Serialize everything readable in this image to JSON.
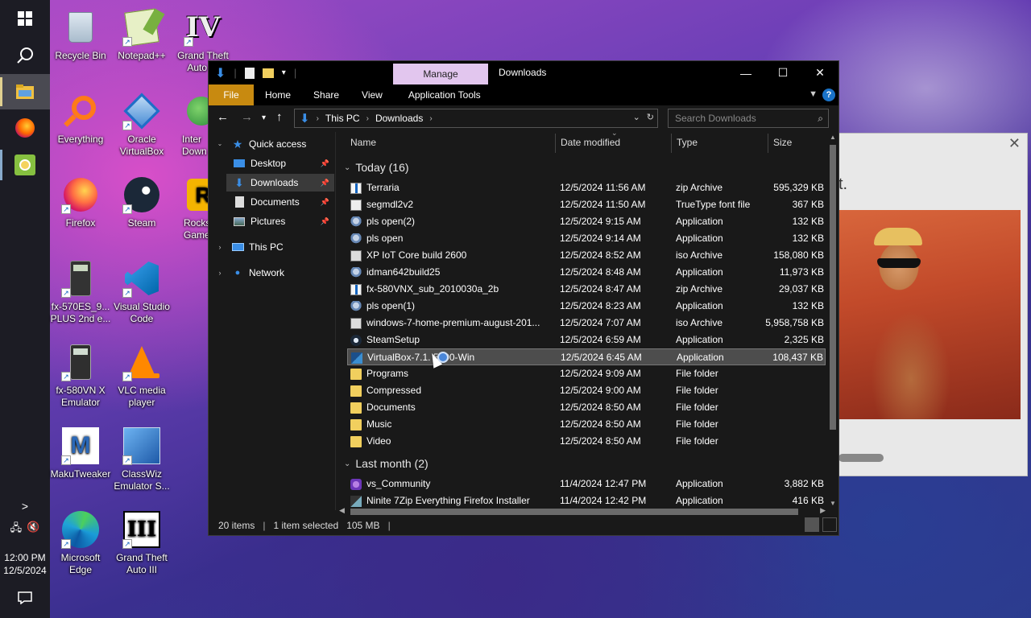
{
  "taskbar": {
    "clock_time": "12:00 PM",
    "clock_date": "12/5/2024"
  },
  "desktop_icons": [
    {
      "label": "Recycle Bin"
    },
    {
      "label": "Notepad++"
    },
    {
      "label": "Grand Theft Auto IV",
      "display": "Grand Theft\nAuto IV"
    },
    {
      "label": "Everything"
    },
    {
      "label": "Oracle VirtualBox",
      "display": "Oracle\nVirtualBox"
    },
    {
      "label": "Internet Download",
      "display": "Inter\nDown"
    },
    {
      "label": "Firefox"
    },
    {
      "label": "Steam"
    },
    {
      "label": "Rockstar Games",
      "display": "Rocks\nGame"
    },
    {
      "label": "fx-570ES PLUS 2nd e...",
      "display": "fx-570ES_9...\nPLUS 2nd e..."
    },
    {
      "label": "Visual Studio Code",
      "display": "Visual Studio\nCode"
    },
    {
      "label": "fx-580VN X Emulator",
      "display": "fx-580VN X\nEmulator"
    },
    {
      "label": "VLC media player",
      "display": "VLC media\nplayer"
    },
    {
      "label": "MakuTweaker"
    },
    {
      "label": "ClassWiz Emulator S...",
      "display": "ClassWiz\nEmulator S..."
    },
    {
      "label": "Microsoft Edge",
      "display": "Microsoft\nEdge"
    },
    {
      "label": "Grand Theft Auto III",
      "display": "Grand Theft\nAuto III"
    }
  ],
  "bg_window": {
    "text": "t."
  },
  "explorer": {
    "title": "Downloads",
    "manage_tab": "Manage",
    "ribbon_tabs": [
      "File",
      "Home",
      "Share",
      "View",
      "Application Tools"
    ],
    "breadcrumb": [
      "This PC",
      "Downloads"
    ],
    "search_placeholder": "Search Downloads",
    "nav": {
      "quick_access": "Quick access",
      "desktop": "Desktop",
      "downloads": "Downloads",
      "documents": "Documents",
      "pictures": "Pictures",
      "this_pc": "This PC",
      "network": "Network"
    },
    "columns": {
      "name": "Name",
      "date": "Date modified",
      "type": "Type",
      "size": "Size"
    },
    "groups": {
      "today": "Today (16)",
      "last_month": "Last month (2)"
    },
    "files": [
      {
        "name": "Terraria",
        "date": "12/5/2024 11:56 AM",
        "type": "zip Archive",
        "size": "595,329 KB",
        "icon": "zip"
      },
      {
        "name": "segmdl2v2",
        "date": "12/5/2024 11:50 AM",
        "type": "TrueType font file",
        "size": "367 KB",
        "icon": "font"
      },
      {
        "name": "pls open(2)",
        "date": "12/5/2024 9:15 AM",
        "type": "Application",
        "size": "132 KB",
        "icon": "app"
      },
      {
        "name": "pls open",
        "date": "12/5/2024 9:14 AM",
        "type": "Application",
        "size": "132 KB",
        "icon": "app"
      },
      {
        "name": "XP IoT Core build 2600",
        "date": "12/5/2024 8:52 AM",
        "type": "iso Archive",
        "size": "158,080 KB",
        "icon": "iso"
      },
      {
        "name": "idman642build25",
        "date": "12/5/2024 8:48 AM",
        "type": "Application",
        "size": "11,973 KB",
        "icon": "app"
      },
      {
        "name": "fx-580VNX_sub_2010030a_2b",
        "date": "12/5/2024 8:47 AM",
        "type": "zip Archive",
        "size": "29,037 KB",
        "icon": "zip"
      },
      {
        "name": "pls open(1)",
        "date": "12/5/2024 8:23 AM",
        "type": "Application",
        "size": "132 KB",
        "icon": "app"
      },
      {
        "name": "windows-7-home-premium-august-201...",
        "date": "12/5/2024 7:07 AM",
        "type": "iso Archive",
        "size": "5,958,758 KB",
        "icon": "iso"
      },
      {
        "name": "SteamSetup",
        "date": "12/5/2024 6:59 AM",
        "type": "Application",
        "size": "2,325 KB",
        "icon": "steam"
      },
      {
        "name": "VirtualBox-7.1.4-165100-Win",
        "display": "VirtualBox-7.1.    5100-Win",
        "date": "12/5/2024 6:45 AM",
        "type": "Application",
        "size": "108,437 KB",
        "icon": "vbox",
        "selected": true
      },
      {
        "name": "Programs",
        "date": "12/5/2024 9:09 AM",
        "type": "File folder",
        "size": "",
        "icon": "folder"
      },
      {
        "name": "Compressed",
        "date": "12/5/2024 9:00 AM",
        "type": "File folder",
        "size": "",
        "icon": "folder"
      },
      {
        "name": "Documents",
        "date": "12/5/2024 8:50 AM",
        "type": "File folder",
        "size": "",
        "icon": "folder"
      },
      {
        "name": "Music",
        "date": "12/5/2024 8:50 AM",
        "type": "File folder",
        "size": "",
        "icon": "folder"
      },
      {
        "name": "Video",
        "date": "12/5/2024 8:50 AM",
        "type": "File folder",
        "size": "",
        "icon": "folder"
      }
    ],
    "files_last_month": [
      {
        "name": "vs_Community",
        "date": "11/4/2024 12:47 PM",
        "type": "Application",
        "size": "3,882 KB",
        "icon": "vs"
      },
      {
        "name": "Ninite 7Zip Everything Firefox Installer",
        "date": "11/4/2024 12:42 PM",
        "type": "Application",
        "size": "416 KB",
        "icon": "ninite"
      }
    ],
    "status": {
      "items": "20 items",
      "selected": "1 item selected",
      "size": "105 MB"
    }
  }
}
